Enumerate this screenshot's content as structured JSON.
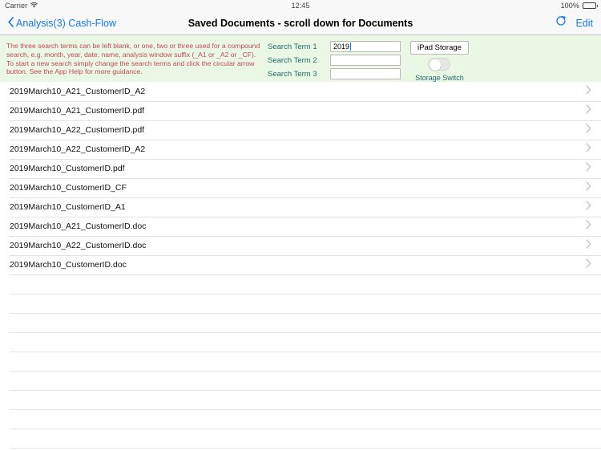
{
  "status_bar": {
    "carrier": "Carrier",
    "wifi_icon": "wifi-icon",
    "time": "12:45",
    "battery_percent": "100%",
    "battery_icon": "battery-full-icon"
  },
  "nav_bar": {
    "back_icon": "chevron-left-icon",
    "back_label": "Analysis(3) Cash-Flow",
    "title": "Saved Documents - scroll down for Documents",
    "refresh_icon": "refresh-circular-arrow-icon",
    "edit_label": "Edit",
    "accent_color": "#1479ea"
  },
  "panel": {
    "background_color": "#eaf7e4",
    "help_text": "The three search terms can be left blank, or one, two or three used for a compound search, e.g. month, year, date, name, analysis window suffix (_A1 or _A2 or _CF). To start a new search simply change the search terms and click the circular arrow button. See the App Help for more guidance.",
    "help_text_color": "#c14a54",
    "label_color": "#1c6b73",
    "search_terms": [
      {
        "label": "Search Term 1",
        "value": "2019",
        "placeholder": "",
        "focused": true
      },
      {
        "label": "Search Term 2",
        "value": "",
        "placeholder": "",
        "focused": false
      },
      {
        "label": "Search Term 3",
        "value": "",
        "placeholder": "",
        "focused": false
      }
    ],
    "storage_button_label": "iPad Storage",
    "storage_switch_label": "Storage Switch",
    "storage_switch_on": false
  },
  "documents": [
    {
      "name": "2019March10_A21_CustomerID_A2",
      "chevron_icon": "chevron-right-icon"
    },
    {
      "name": "2019March10_A21_CustomerID.pdf",
      "chevron_icon": "chevron-right-icon"
    },
    {
      "name": "2019March10_A22_CustomerID.pdf",
      "chevron_icon": "chevron-right-icon"
    },
    {
      "name": "2019March10_A22_CustomerID_A2",
      "chevron_icon": "chevron-right-icon"
    },
    {
      "name": "2019March10_CustomerID.pdf",
      "chevron_icon": "chevron-right-icon"
    },
    {
      "name": "2019March10_CustomerID_CF",
      "chevron_icon": "chevron-right-icon"
    },
    {
      "name": "2019March10_CustomerID_A1",
      "chevron_icon": "chevron-right-icon"
    },
    {
      "name": "2019March10_A21_CustomerID.doc",
      "chevron_icon": "chevron-right-icon"
    },
    {
      "name": "2019March10_A22_CustomerID.doc",
      "chevron_icon": "chevron-right-icon"
    },
    {
      "name": "2019March10_CustomerID.doc",
      "chevron_icon": "chevron-right-icon"
    }
  ],
  "empty_row_count": 9
}
